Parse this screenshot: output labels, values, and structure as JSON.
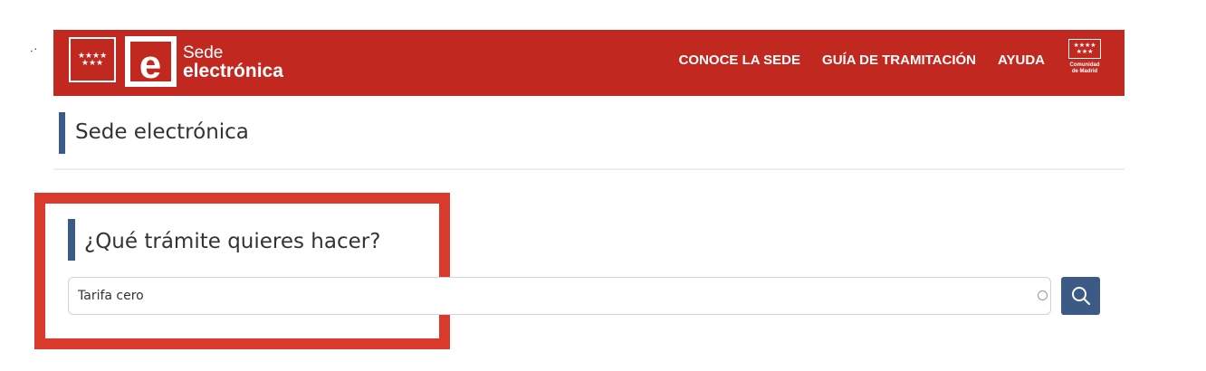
{
  "header": {
    "brand_line1": "Sede",
    "brand_line2": "electrónica",
    "nav": [
      {
        "label": "CONOCE LA SEDE"
      },
      {
        "label": "GUÍA DE TRAMITACIÓN"
      },
      {
        "label": "AYUDA"
      }
    ],
    "region_logo_line1": "Comunidad",
    "region_logo_line2": "de Madrid",
    "brand_color": "#c1281f"
  },
  "page": {
    "title": "Sede electrónica"
  },
  "search": {
    "heading": "¿Qué trámite quieres hacer?",
    "value": "Tarifa cero",
    "button_icon": "search-icon"
  },
  "accent_color": "#3a5a87",
  "highlight_color": "#d93a2b"
}
